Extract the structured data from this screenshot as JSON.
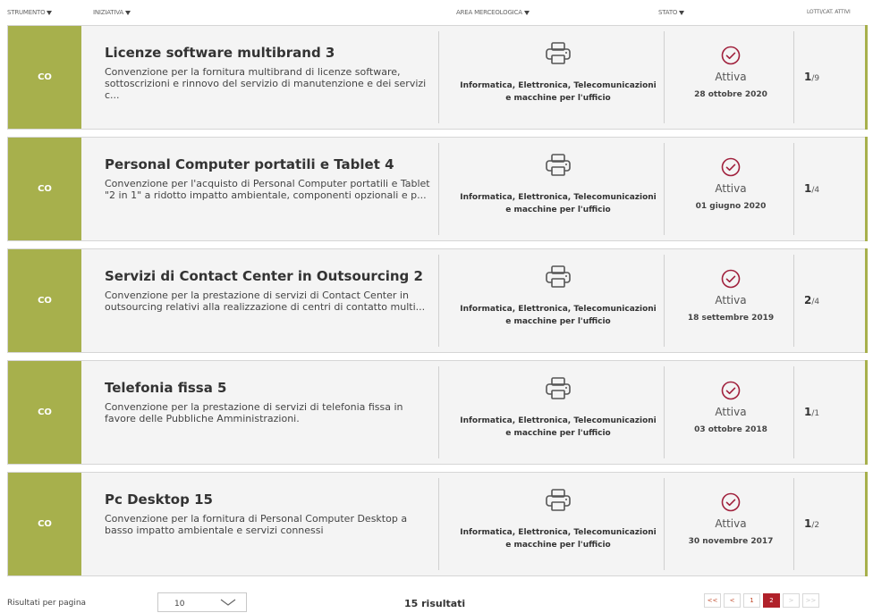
{
  "header": {
    "strumento": "STRUMENTO",
    "iniziativa": "INIZIATIVA",
    "area": "AREA MERCEOLOGICA",
    "stato": "STATO",
    "lotti": "LOTTI/CAT. ATTIVI"
  },
  "rows": [
    {
      "strumento": "CO",
      "title": "Licenze software multibrand 3",
      "desc": "Convenzione per la fornitura multibrand di licenze software, sottoscrizioni e rinnovo del servizio di manutenzione e dei servizi c...",
      "area": "Informatica, Elettronica, Telecomunicazioni e macchine per l'ufficio",
      "stato": "Attiva",
      "date": "28 ottobre 2020",
      "lotti_num": "1",
      "lotti_den": "/9"
    },
    {
      "strumento": "CO",
      "title": "Personal Computer portatili e Tablet 4",
      "desc": "Convenzione per l'acquisto di Personal Computer portatili e Tablet \"2 in 1\" a ridotto impatto ambientale, componenti opzionali e p...",
      "area": "Informatica, Elettronica, Telecomunicazioni e macchine per l'ufficio",
      "stato": "Attiva",
      "date": "01 giugno 2020",
      "lotti_num": "1",
      "lotti_den": "/4"
    },
    {
      "strumento": "CO",
      "title": "Servizi di Contact Center in Outsourcing 2",
      "desc": "Convenzione per la prestazione di servizi di Contact Center in outsourcing relativi alla realizzazione di centri di contatto multi...",
      "area": "Informatica, Elettronica, Telecomunicazioni e macchine per l'ufficio",
      "stato": "Attiva",
      "date": "18 settembre 2019",
      "lotti_num": "2",
      "lotti_den": "/4"
    },
    {
      "strumento": "CO",
      "title": "Telefonia fissa 5",
      "desc": "Convenzione per la prestazione di servizi di telefonia fissa in favore delle Pubbliche Amministrazioni.",
      "area": "Informatica, Elettronica, Telecomunicazioni e macchine per l'ufficio",
      "stato": "Attiva",
      "date": "03 ottobre 2018",
      "lotti_num": "1",
      "lotti_den": "/1"
    },
    {
      "strumento": "CO",
      "title": "Pc Desktop 15",
      "desc": "Convenzione per la fornitura di Personal Computer Desktop a basso impatto ambientale e servizi connessi",
      "area": "Informatica, Elettronica, Telecomunicazioni e macchine per l'ufficio",
      "stato": "Attiva",
      "date": "30 novembre 2017",
      "lotti_num": "1",
      "lotti_den": "/2"
    }
  ],
  "footer": {
    "per_page_label": "Risultati per pagina",
    "per_page_value": "10",
    "results": "15 risultati",
    "pagination": [
      "<<",
      "<",
      "1",
      "2",
      ">",
      ">>"
    ],
    "current_page": "2"
  },
  "colors": {
    "strip": "#a7b04c",
    "stato_icon": "#a0203c",
    "page_active": "#b0212a"
  },
  "icons": {
    "area": "printer-icon",
    "stato": "check-circle-icon",
    "sort": "sort-down-icon"
  }
}
